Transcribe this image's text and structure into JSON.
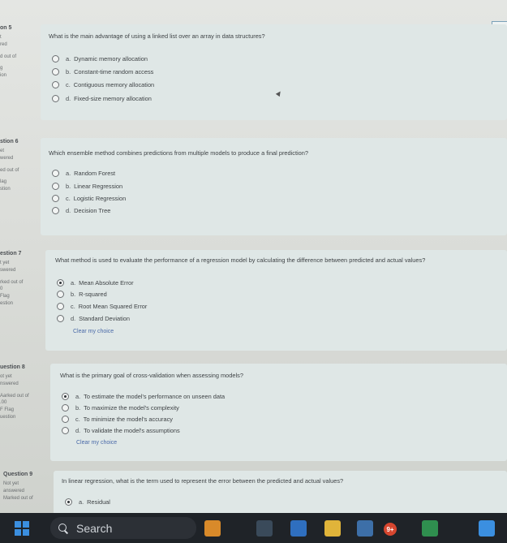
{
  "timer_tab": "Ti",
  "questions": [
    {
      "info": {
        "qnum": "on 5",
        "lines": [
          "t",
          "red",
          "",
          "d out of",
          "",
          "g",
          "ion"
        ]
      },
      "text": "What is the main advantage of using a linked list over an array in data structures?",
      "options": [
        {
          "letter": "a.",
          "text": "Dynamic memory allocation",
          "selected": false
        },
        {
          "letter": "b.",
          "text": "Constant-time random access",
          "selected": false
        },
        {
          "letter": "c.",
          "text": "Contiguous memory allocation",
          "selected": false
        },
        {
          "letter": "d.",
          "text": "Fixed-size memory allocation",
          "selected": false
        }
      ]
    },
    {
      "info": {
        "qnum": "stion 6",
        "lines": [
          "et",
          "wered",
          "",
          "ed out of",
          "",
          "lag",
          "stion"
        ]
      },
      "text": "Which ensemble method combines predictions from multiple models to produce a final prediction?",
      "options": [
        {
          "letter": "a.",
          "text": "Random Forest",
          "selected": false
        },
        {
          "letter": "b.",
          "text": "Linear Regression",
          "selected": false
        },
        {
          "letter": "c.",
          "text": "Logistic Regression",
          "selected": false
        },
        {
          "letter": "d.",
          "text": "Decision Tree",
          "selected": false
        }
      ]
    },
    {
      "info": {
        "qnum": "estion 7",
        "lines": [
          "t yet",
          "swered",
          "",
          "rked out of",
          "0",
          "Flag",
          "estion"
        ]
      },
      "text": "What method is used to evaluate the performance of a regression model by calculating the difference between predicted and actual values?",
      "options": [
        {
          "letter": "a.",
          "text": "Mean Absolute Error",
          "selected": true
        },
        {
          "letter": "b.",
          "text": "R-squared",
          "selected": false
        },
        {
          "letter": "c.",
          "text": "Root Mean Squared Error",
          "selected": false
        },
        {
          "letter": "d.",
          "text": "Standard Deviation",
          "selected": false
        }
      ],
      "clear": "Clear my choice"
    },
    {
      "info": {
        "qnum": "uestion 8",
        "lines": [
          "ot yet",
          "nswered",
          "",
          "Aarked out of",
          ".00",
          "F Flag",
          "uestion"
        ]
      },
      "text": "What is the primary goal of cross-validation when assessing models?",
      "options": [
        {
          "letter": "a.",
          "text": "To estimate the model's performance on unseen data",
          "selected": true
        },
        {
          "letter": "b.",
          "text": "To maximize the model's complexity",
          "selected": false
        },
        {
          "letter": "c.",
          "text": "To minimize the model's accuracy",
          "selected": false
        },
        {
          "letter": "d.",
          "text": "To validate the model's assumptions",
          "selected": false
        }
      ],
      "clear": "Clear my choice"
    },
    {
      "info": {
        "qnum": "Question 9",
        "lines": [
          "Not yet",
          "answered",
          "Marked out of"
        ]
      },
      "text": "In linear regression, what is the term used to represent the error between the predicted and actual values?",
      "options": [
        {
          "letter": "a.",
          "text": "Residual",
          "selected": true
        }
      ]
    }
  ],
  "taskbar": {
    "search_label": "Search",
    "badge": "9+"
  }
}
